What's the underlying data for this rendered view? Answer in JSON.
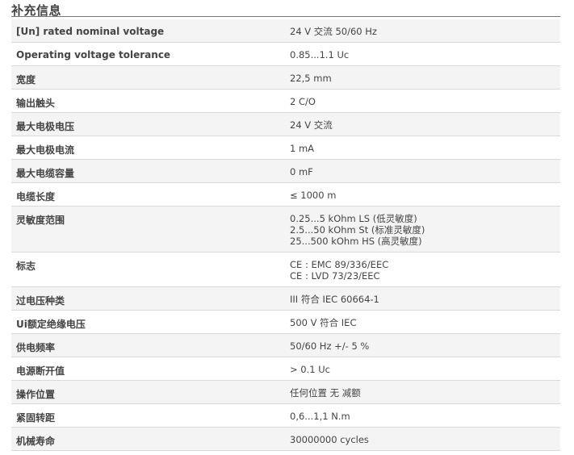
{
  "section": {
    "title": "补充信息"
  },
  "rows": [
    {
      "label": "[Un] rated nominal voltage",
      "values": [
        "24 V 交流 50/60 Hz"
      ]
    },
    {
      "label": "Operating voltage tolerance",
      "values": [
        "0.85...1.1 Uc"
      ]
    },
    {
      "label": "宽度",
      "values": [
        "22,5 mm"
      ]
    },
    {
      "label": "输出触头",
      "values": [
        "2 C/O"
      ]
    },
    {
      "label": "最大电极电压",
      "values": [
        "24 V 交流"
      ]
    },
    {
      "label": "最大电极电流",
      "values": [
        "1 mA"
      ]
    },
    {
      "label": "最大电缆容量",
      "values": [
        "0 mF"
      ]
    },
    {
      "label": "电缆长度",
      "values": [
        "≤ 1000 m"
      ]
    },
    {
      "label": "灵敏度范围",
      "values": [
        "0.25...5 kOhm LS (低灵敏度)",
        "2.5...50 kOhm St (标准灵敏度)",
        "25...500 kOhm HS (高灵敏度)"
      ]
    },
    {
      "label": "标志",
      "values": [
        "CE : EMC 89/336/EEC",
        "CE : LVD 73/23/EEC"
      ]
    },
    {
      "label": "过电压种类",
      "values": [
        "III 符合 IEC 60664-1"
      ]
    },
    {
      "label": "Ui额定绝缘电压",
      "values": [
        "500 V 符合 IEC"
      ]
    },
    {
      "label": "供电频率",
      "values": [
        "50/60 Hz +/- 5 %"
      ]
    },
    {
      "label": "电源断开值",
      "values": [
        "> 0.1 Uc"
      ]
    },
    {
      "label": "操作位置",
      "values": [
        "任何位置 无 减额"
      ]
    },
    {
      "label": "紧固转距",
      "values": [
        "0,6...1,1 N.m"
      ]
    },
    {
      "label": "机械寿命",
      "values": [
        "30000000 cycles"
      ]
    }
  ]
}
